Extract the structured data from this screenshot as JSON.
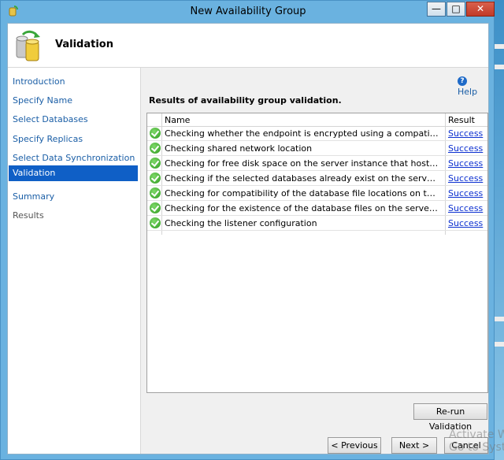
{
  "window": {
    "title": "New Availability Group",
    "buttons": {
      "minimize": "—",
      "maximize": "□",
      "close": "✕"
    }
  },
  "header": {
    "title": "Validation",
    "icon": "database-sync-icon"
  },
  "nav": {
    "items": [
      {
        "label": "Introduction",
        "state": "link"
      },
      {
        "label": "Specify Name",
        "state": "link"
      },
      {
        "label": "Select Databases",
        "state": "link"
      },
      {
        "label": "Specify Replicas",
        "state": "link"
      },
      {
        "label": "Select Data Synchronization",
        "state": "link"
      },
      {
        "label": "Validation",
        "state": "active"
      },
      {
        "label": "Summary",
        "state": "link"
      },
      {
        "label": "Results",
        "state": "disabled"
      }
    ]
  },
  "help": {
    "label": "Help",
    "icon": "help-icon"
  },
  "results": {
    "heading": "Results of availability group validation.",
    "columns": {
      "name": "Name",
      "result": "Result"
    },
    "rows": [
      {
        "name": "Checking whether the endpoint is encrypted using a compatible algorithm",
        "result": "Success"
      },
      {
        "name": "Checking shared network location",
        "result": "Success"
      },
      {
        "name": "Checking for free disk space on the server instance that hosts secondary re...",
        "result": "Success"
      },
      {
        "name": "Checking if the selected databases already exist on the server instance that ...",
        "result": "Success"
      },
      {
        "name": "Checking for compatibility of the database file locations on the server insta...",
        "result": "Success"
      },
      {
        "name": "Checking for the existence of the database files on the server instance that ...",
        "result": "Success"
      },
      {
        "name": "Checking the listener configuration",
        "result": "Success"
      }
    ]
  },
  "buttons": {
    "rerun": "Re-run Validation",
    "previous": "< Previous",
    "next": "Next >",
    "cancel": "Cancel"
  },
  "watermark": {
    "line1": "Activate W",
    "line2": "Go to Syste"
  }
}
